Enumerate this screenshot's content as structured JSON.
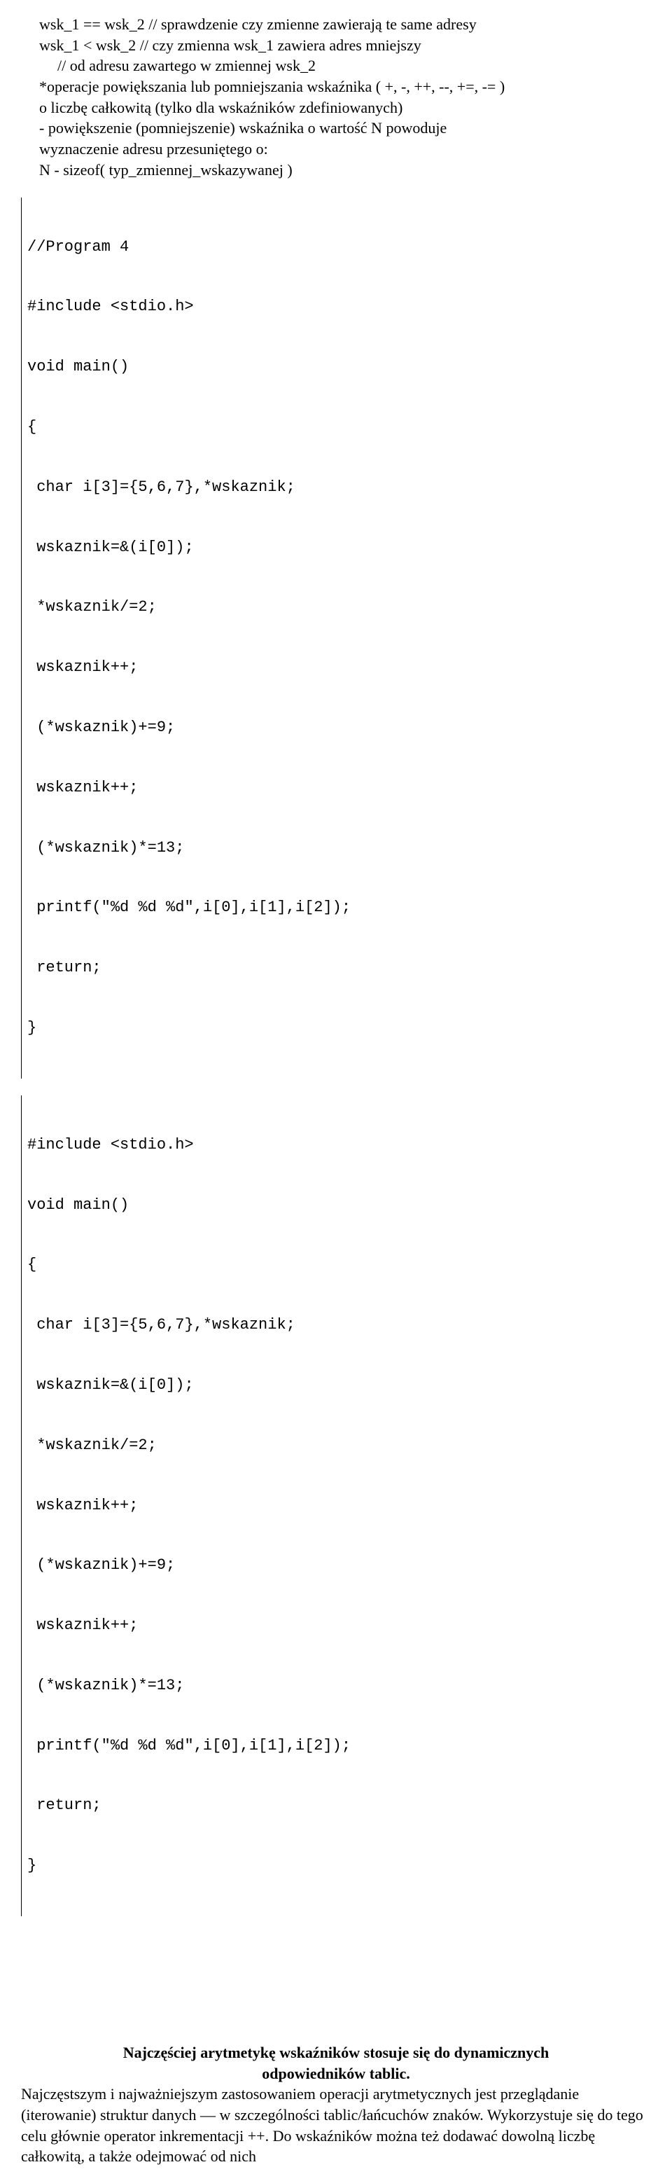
{
  "doc": {
    "line1": "wsk_1 == wsk_2 // sprawdzenie czy zmienne zawierają te same adresy",
    "line2": "wsk_1 < wsk_2   // czy zmienna wsk_1 zawiera adres mniejszy",
    "line3": "// od adresu zawartego w zmiennej wsk_2",
    "line4": "*operacje powiększania lub pomniejszania wskaźnika ( +, -, ++, --, +=, -= )",
    "line5": "o liczbę całkowitą (tylko dla wskaźników zdefiniowanych)",
    "line6": "- powiększenie (pomniejszenie) wskaźnika o wartość N powoduje",
    "line7": "wyznaczenie adresu przesuniętego o:",
    "line8": "N - sizeof( typ_zmiennej_wskazywanej )"
  },
  "code1": {
    "l1": "//Program 4",
    "l2": "#include <stdio.h>",
    "l3": "void main()",
    "l4": "{",
    "l5": " char i[3]={5,6,7},*wskaznik;",
    "l6": " wskaznik=&(i[0]);",
    "l7": " *wskaznik/=2;",
    "l8": " wskaznik++;",
    "l9": " (*wskaznik)+=9;",
    "l10": " wskaznik++;",
    "l11": " (*wskaznik)*=13;",
    "l12": " printf(\"%d %d %d\",i[0],i[1],i[2]);",
    "l13": " return;",
    "l14": "}"
  },
  "code2": {
    "l1": "#include <stdio.h>",
    "l2": "void main()",
    "l3": "{",
    "l4": " char i[3]={5,6,7},*wskaznik;",
    "l5": " wskaznik=&(i[0]);",
    "l6": " *wskaznik/=2;",
    "l7": " wskaznik++;",
    "l8": " (*wskaznik)+=9;",
    "l9": " wskaznik++;",
    "l10": " (*wskaznik)*=13;",
    "l11": " printf(\"%d %d %d\",i[0],i[1],i[2]);",
    "l12": " return;",
    "l13": "}"
  },
  "footer": {
    "h1": "Najczęściej arytmetykę wskaźników stosuje się do dynamicznych",
    "h2": "odpowiedników tablic.",
    "body": "Najczęstszym i najważniejszym zastosowaniem operacji arytmetycznych jest przeglądanie (iterowanie) struktur danych — w szczególności tablic/łańcuchów znaków. Wykorzystuje się do tego celu głównie operator inkrementacji ++. Do wskaźników można też dodawać dowolną liczbę całkowitą, a także odejmować od nich"
  }
}
